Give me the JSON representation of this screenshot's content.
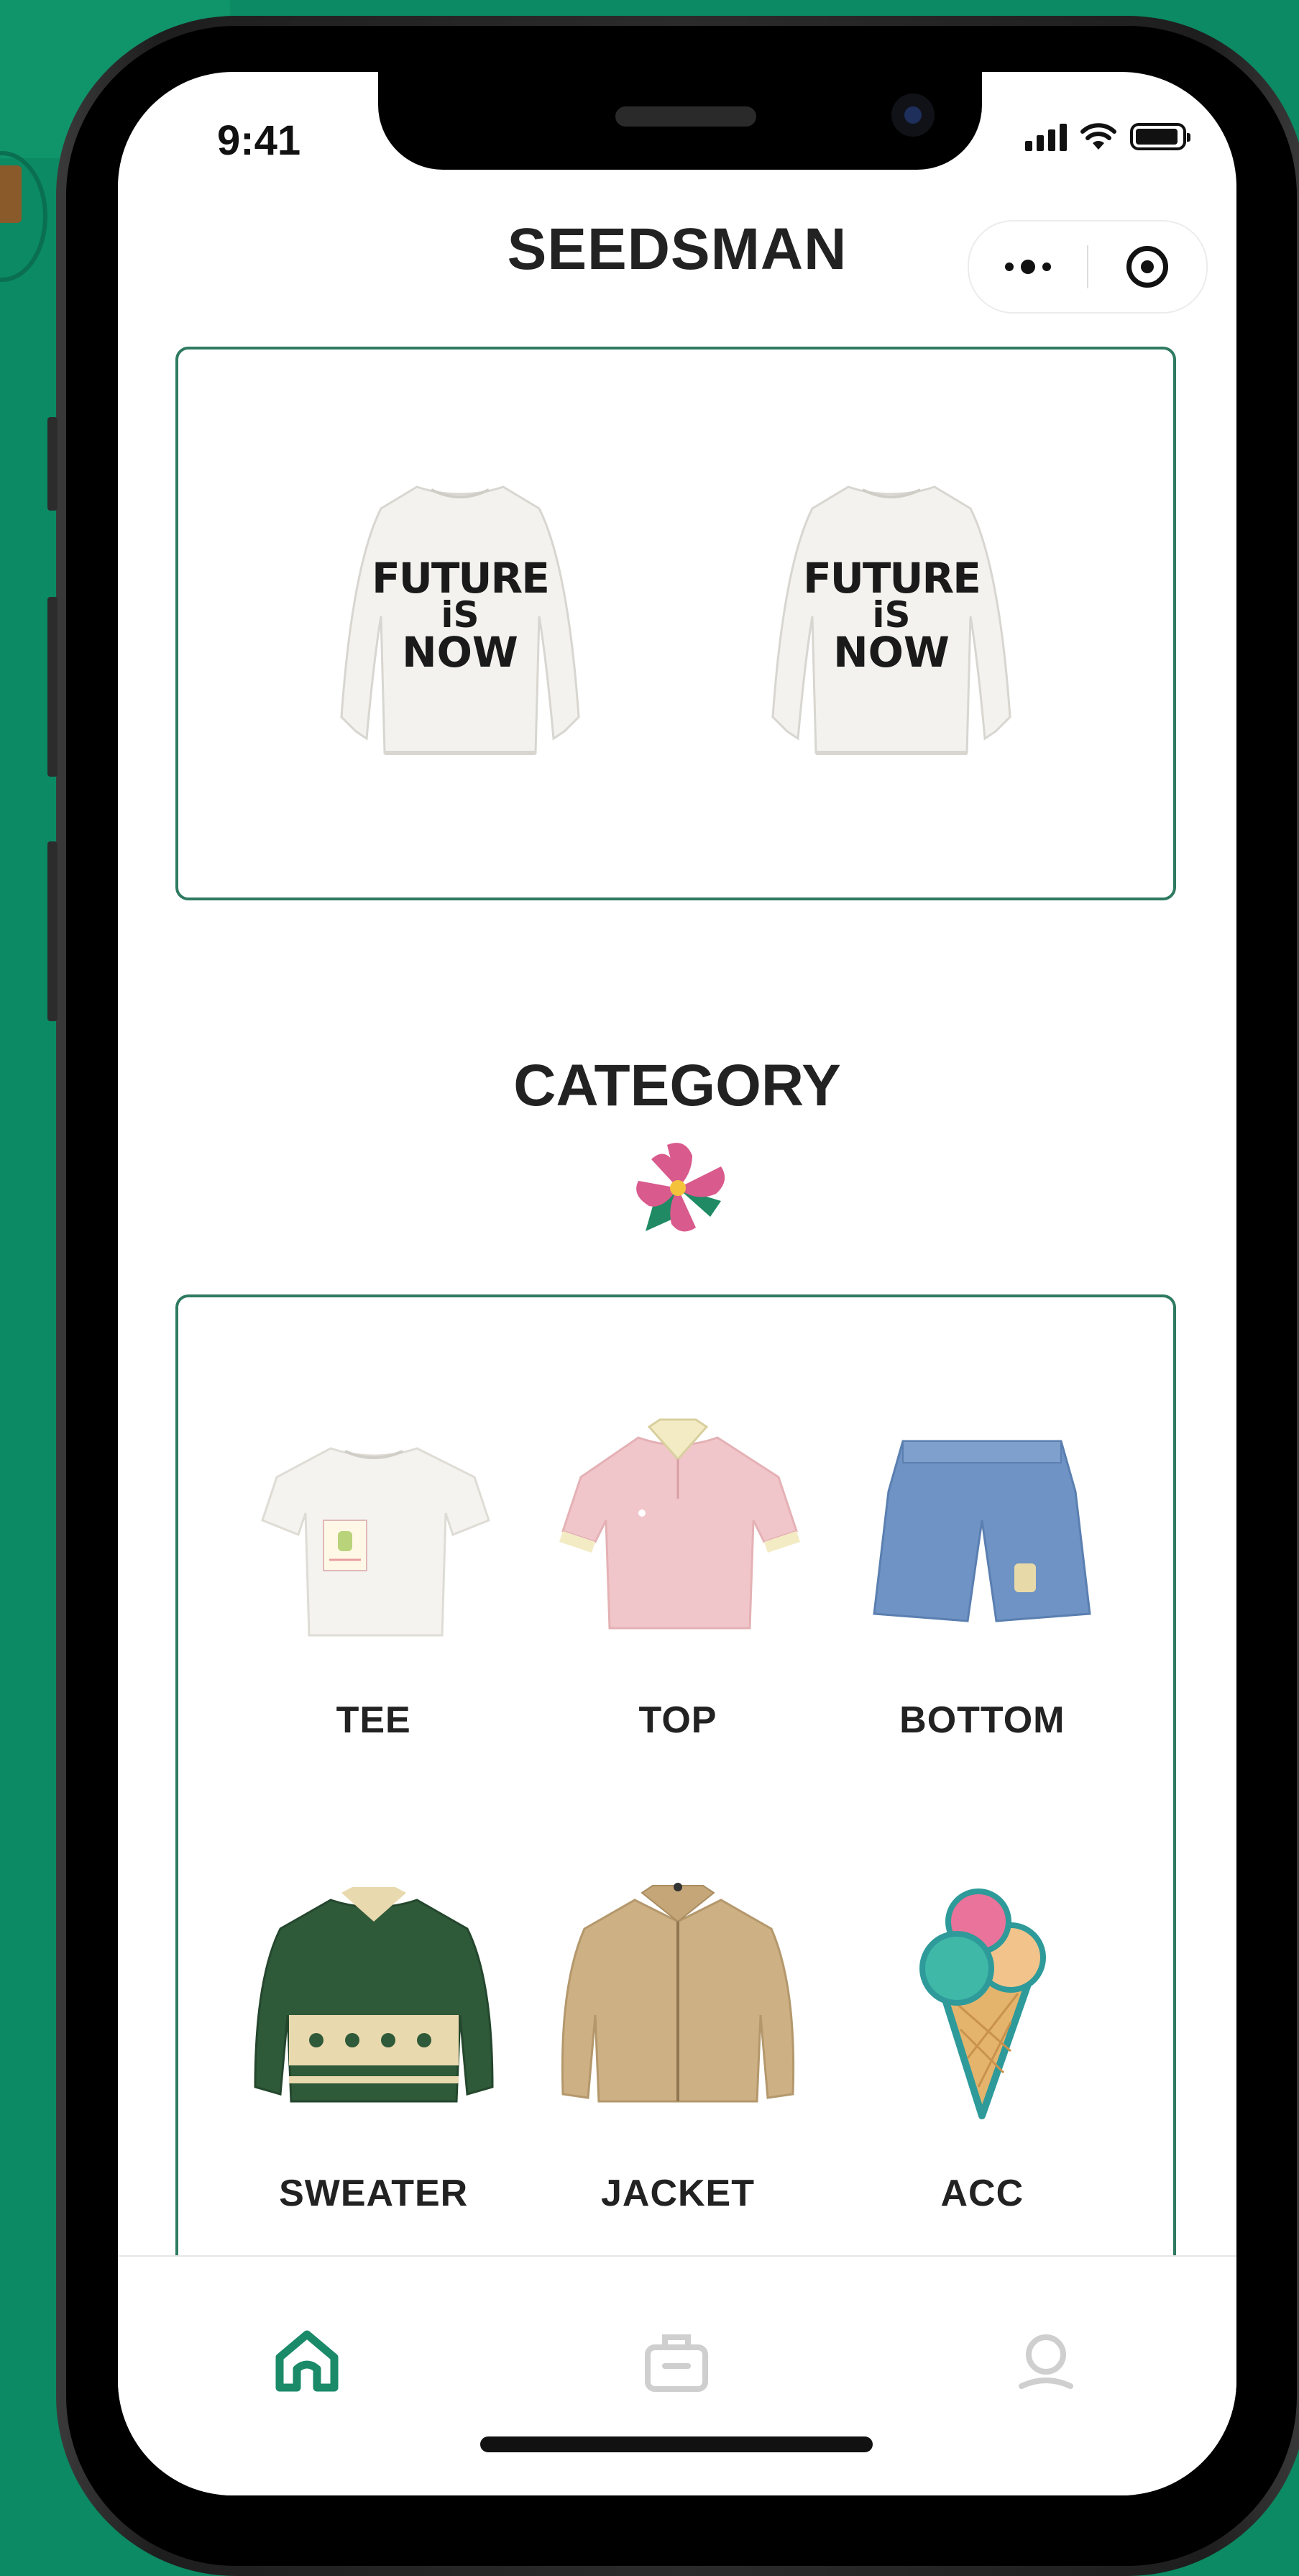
{
  "status_bar": {
    "time": "9:41"
  },
  "header": {
    "title": "SEEDSMAN",
    "more_icon": "more-dots-icon",
    "close_icon": "target-close-icon"
  },
  "banner": {
    "items": [
      {
        "print_line1": "FUTURE",
        "print_line2": "iS",
        "print_line3": "NOW"
      },
      {
        "print_line1": "FUTURE",
        "print_line2": "iS",
        "print_line3": "NOW"
      }
    ]
  },
  "category": {
    "title": "CATEGORY",
    "items": [
      {
        "label": "TEE",
        "icon": "tee-image"
      },
      {
        "label": "TOP",
        "icon": "polo-image"
      },
      {
        "label": "BOTTOM",
        "icon": "shorts-image"
      },
      {
        "label": "SWEATER",
        "icon": "sweater-image"
      },
      {
        "label": "JACKET",
        "icon": "jacket-image"
      },
      {
        "label": "ACC",
        "icon": "ice-cream-pillow-image"
      }
    ]
  },
  "tabbar": {
    "tabs": [
      {
        "icon": "home-icon",
        "active": true
      },
      {
        "icon": "bag-icon",
        "active": false
      },
      {
        "icon": "profile-icon",
        "active": false
      }
    ]
  },
  "colors": {
    "background": "#0b8a63",
    "accent": "#2f7a62",
    "tab_active": "#1a8a68",
    "tab_inactive": "#cfcfcf"
  }
}
